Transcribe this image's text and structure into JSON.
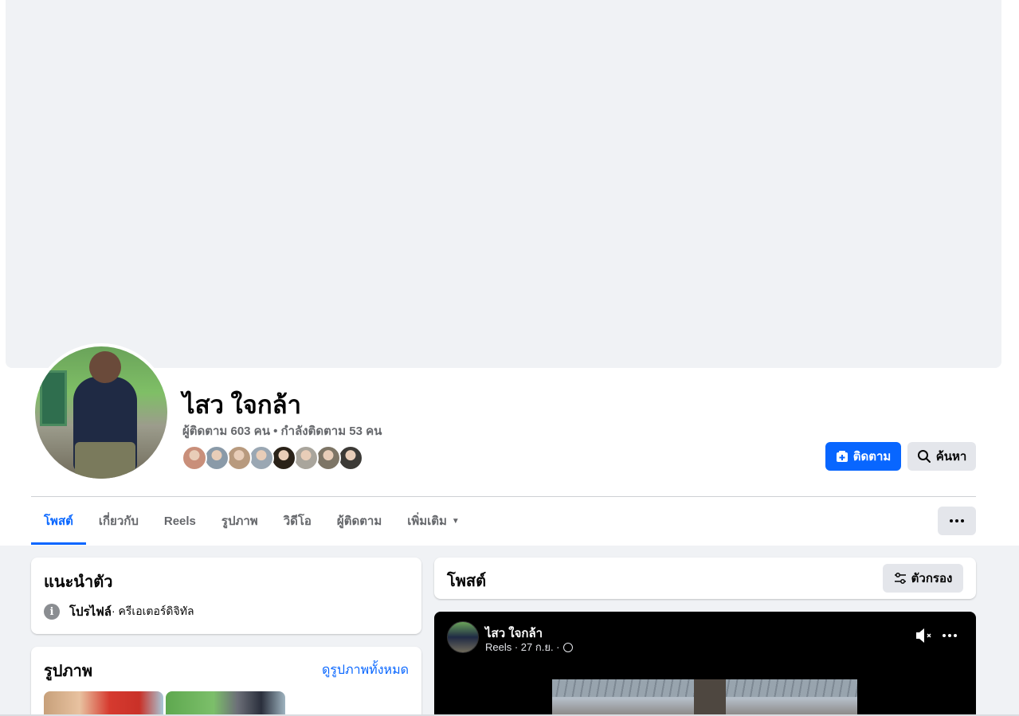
{
  "profile": {
    "name": "ไสว ใจกล้า",
    "stats": "ผู้ติดตาม 603 คน • กำลังติดตาม 53 คน"
  },
  "actions": {
    "follow_label": "ติดตาม",
    "search_label": "ค้นหา"
  },
  "tabs": [
    {
      "label": "โพสต์",
      "active": true
    },
    {
      "label": "เกี่ยวกับ"
    },
    {
      "label": "Reels"
    },
    {
      "label": "รูปภาพ"
    },
    {
      "label": "วิดีโอ"
    },
    {
      "label": "ผู้ติดตาม"
    },
    {
      "label": "เพิ่มเติม"
    }
  ],
  "intro": {
    "title": "แนะนำตัว",
    "label": "โปรไฟล์",
    "detail": " · ครีเอเตอร์ดิจิทัล"
  },
  "photos": {
    "title": "รูปภาพ",
    "see_all": "ดูรูปภาพทั้งหมด"
  },
  "posts": {
    "title": "โพสต์",
    "filter_label": "ตัวกรอง"
  },
  "reel": {
    "author": "ไสว ใจกล้า",
    "meta": "Reels · 27 ก.ย. ·"
  },
  "colors": {
    "accent": "#0866ff",
    "page_bg": "#f0f2f5",
    "button_gray": "#e4e6eb"
  },
  "friend_avatar_colors": [
    "#c98f7a",
    "#8a9aa8",
    "#b89a7e",
    "#9aa7b3",
    "#2a2218",
    "#a9a59c",
    "#7d7566",
    "#3c3a36"
  ]
}
